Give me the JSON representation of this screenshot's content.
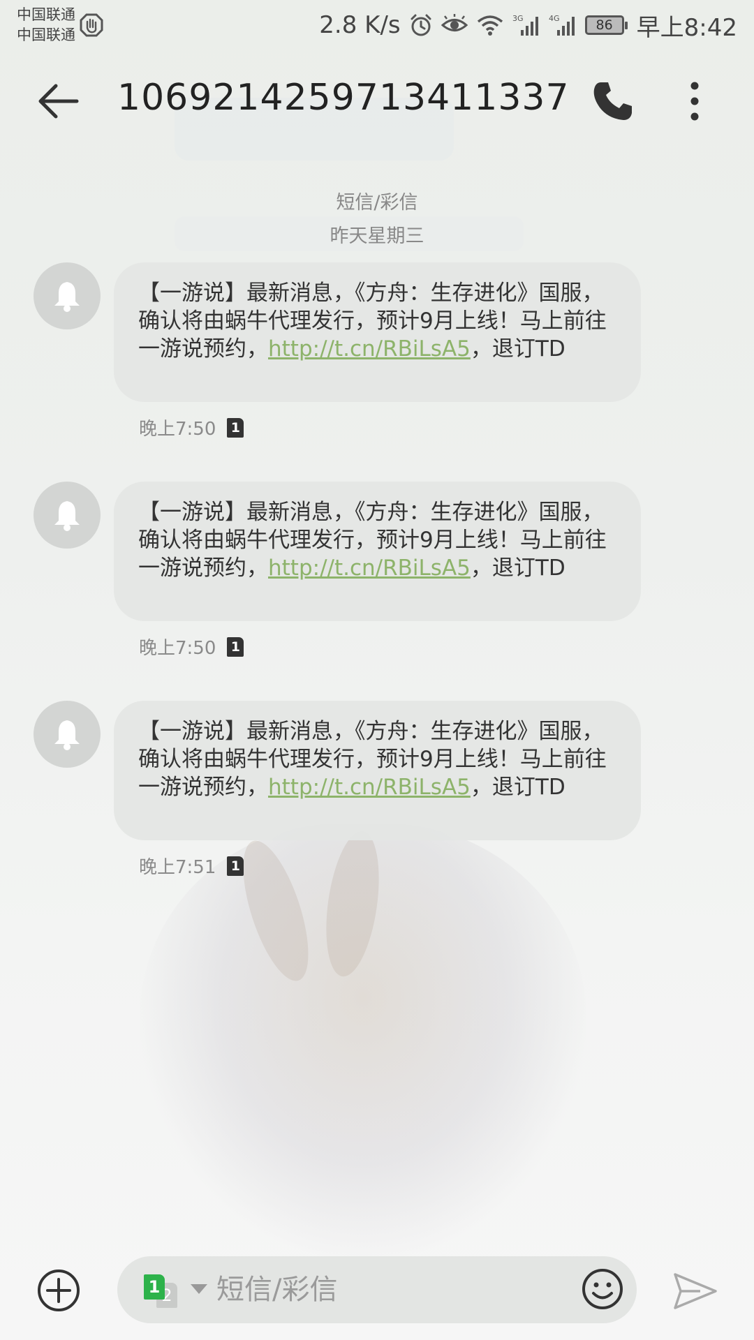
{
  "status_bar": {
    "carrier_1": "中国联通",
    "carrier_2": "中国联通",
    "net_speed": "2.8 K/s",
    "signal_1_type": "3G",
    "signal_2_type": "4G",
    "battery": "86",
    "time": "早上8:42"
  },
  "header": {
    "title": "1069214259713411337"
  },
  "conversation": {
    "type_label": "短信/彩信",
    "date_label": "昨天星期三"
  },
  "messages": [
    {
      "text": "【一游说】最新消息，《方舟：生存进化》国服，确认将由蜗牛代理发行，预计9月上线！马上前往一游说预约，",
      "link": "http://t.cn/RBiLsA5",
      "suffix": "，退订TD",
      "time": "晚上7:50",
      "sim": "1"
    },
    {
      "text": "【一游说】最新消息，《方舟：生存进化》国服，确认将由蜗牛代理发行，预计9月上线！马上前往一游说预约，",
      "link": "http://t.cn/RBiLsA5",
      "suffix": "，退订TD",
      "time": "晚上7:50",
      "sim": "1"
    },
    {
      "text": "【一游说】最新消息，《方舟：生存进化》国服，确认将由蜗牛代理发行，预计9月上线！马上前往一游说预约，",
      "link": "http://t.cn/RBiLsA5",
      "suffix": "，退订TD",
      "time": "晚上7:51",
      "sim": "1"
    }
  ],
  "composer": {
    "placeholder": "短信/彩信",
    "sim_active": "1",
    "sim_inactive": "2"
  },
  "icons": {
    "back": "arrow-left-icon",
    "call": "phone-icon",
    "more": "more-vertical-icon",
    "avatar": "bell-icon",
    "add": "plus-circle-icon",
    "emoji": "smiley-icon",
    "send": "send-icon"
  },
  "colors": {
    "link": "#8db36a",
    "sim_active": "#2db24a"
  }
}
